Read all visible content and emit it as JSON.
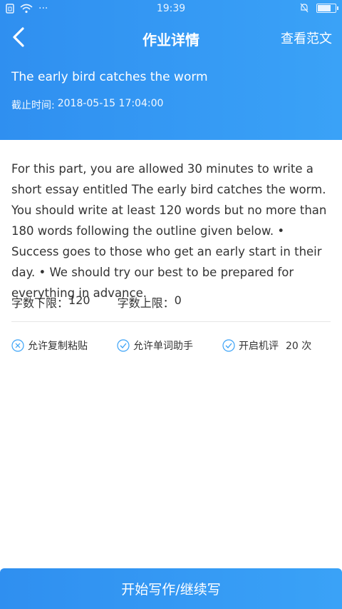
{
  "status": {
    "time": "19:39",
    "dots": "···"
  },
  "nav": {
    "title": "作业详情",
    "right_link": "查看范文"
  },
  "assignment": {
    "title": "The early bird catches the worm",
    "deadline_label": "截止时间:",
    "deadline_value": "2018-05-15 17:04:00",
    "prompt": "For this part, you are allowed 30 minutes to write a short essay entitled The early bird catches the worm. You should write at least 120 words but no more than 180 words following the outline given below. • Success goes to those who get an early start in their day. • We should try our best to be prepared for everything in advance.",
    "min_words_label": "字数下限：",
    "min_words_value": "120",
    "max_words_label": "字数上限：",
    "max_words_value": "0"
  },
  "features": [
    {
      "label": "允许复制粘贴",
      "icon": "x-circle-icon",
      "enabled": false
    },
    {
      "label": "允许单词助手",
      "icon": "check-circle-icon",
      "enabled": true
    },
    {
      "label": "开启机评",
      "count": "20 次",
      "icon": "check-circle-icon",
      "enabled": true
    }
  ],
  "cta": {
    "label": "开始写作/继续写"
  },
  "colors": {
    "primary": "#2f8ff0",
    "icon_blue": "#3aa2f7",
    "text": "#333333"
  }
}
